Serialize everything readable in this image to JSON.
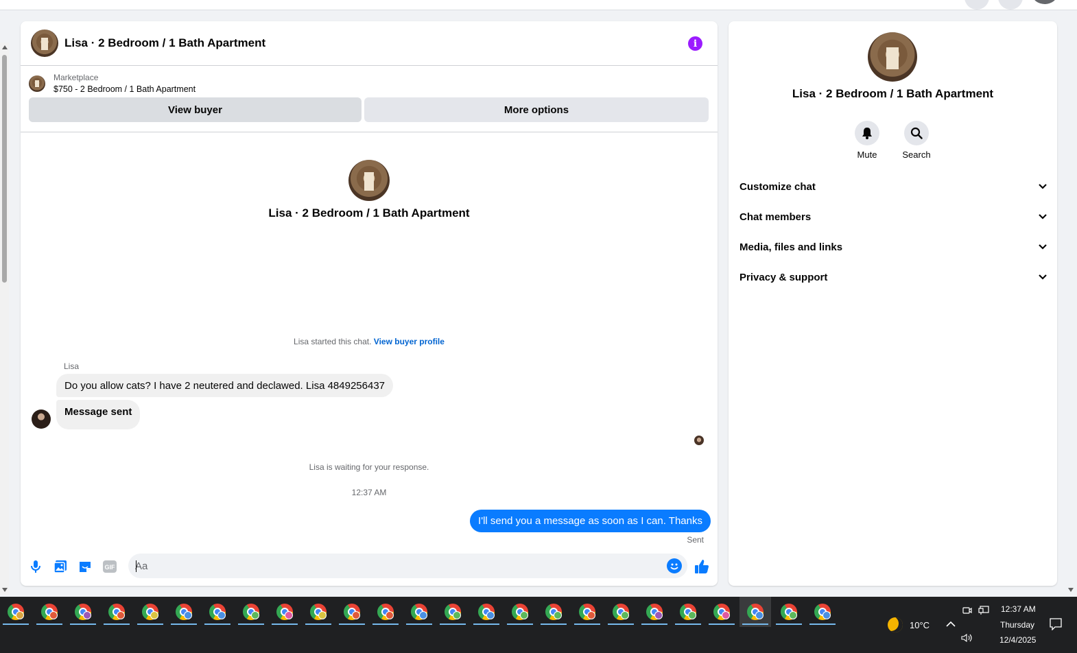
{
  "chat": {
    "title": "Lisa · 2 Bedroom / 1 Bath Apartment",
    "listing": {
      "category": "Marketplace",
      "title": "$750 - 2 Bedroom / 1 Bath Apartment",
      "view_buyer": "View buyer",
      "more_options": "More options"
    },
    "thread_title": "Lisa · 2 Bedroom / 1 Bath Apartment",
    "started_text": "Lisa started this chat.",
    "view_profile_link": "View buyer profile",
    "sender_name": "Lisa",
    "messages_in": [
      "Do you allow cats? I have 2 neutered and declawed. Lisa 4849256437",
      "Message sent"
    ],
    "waiting_text": "Lisa is waiting for your response.",
    "timestamp": "12:37 AM",
    "message_out": "I'll send you a message as soon as I can. Thanks",
    "sent_label": "Sent",
    "composer": {
      "placeholder": "Aa",
      "icons": [
        "microphone-icon",
        "photo-icon",
        "sticker-icon",
        "gif-icon",
        "emoji-icon",
        "thumbs-up-icon"
      ]
    }
  },
  "side": {
    "title": "Lisa · 2 Bedroom / 1 Bath Apartment",
    "actions": [
      {
        "label": "Mute",
        "icon": "bell-icon"
      },
      {
        "label": "Search",
        "icon": "search-icon"
      }
    ],
    "sections": [
      "Customize chat",
      "Chat members",
      "Media, files and links",
      "Privacy & support"
    ]
  },
  "taskbar": {
    "weather": "10°C",
    "time": "12:37 AM",
    "day": "Thursday",
    "date": "12/4/2025",
    "badge_colors": [
      "#d9a441",
      "#e05a3a",
      "#9b59b6",
      "#e05a3a",
      "#d9c441",
      "#4a90e2",
      "#4a90e2",
      "#5cb85c",
      "#e05aa0",
      "#d9c441",
      "#e05a3a",
      "#e05a3a",
      "#4a90e2",
      "#5cb85c",
      "#4a90e2",
      "#5cb85c",
      "#5cb85c",
      "#e05a3a",
      "#5cb85c",
      "#9b59b6",
      "#5cb85c",
      "#e05aa0",
      "#4a90e2",
      "#5cb85c",
      "#4a90e2"
    ]
  },
  "colors": {
    "accent": "#0a7cff",
    "info": "#9b1cff",
    "link": "#0064d1"
  }
}
